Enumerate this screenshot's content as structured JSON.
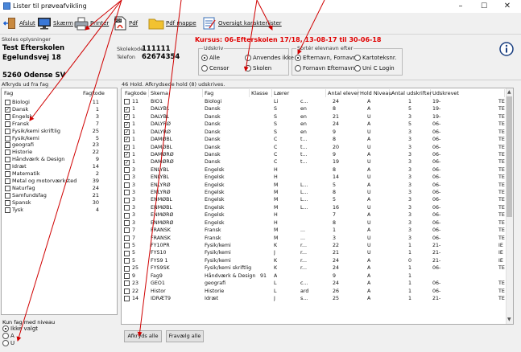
{
  "window": {
    "title": "Lister til prøveafvikling",
    "min": "–",
    "max": "☐",
    "close": "✕"
  },
  "toolbar": {
    "afslut": "Afslut",
    "skaerm": "Skærm",
    "printer": "Printer",
    "pdf": "Pdf",
    "pdf_mappe": "Pdf mappe",
    "oversigt": "Oversigt karakterlister"
  },
  "info": {
    "skoles_label": "Skoles oplysninger",
    "school_name": "Test Efterskolen",
    "street": "Egelundsvej 18",
    "postal": "5260 Odense SV",
    "skolekode_label": "Skolekode",
    "skolekode": "111111",
    "telefon_label": "Telefon",
    "telefon": "62674354",
    "kursus": "Kursus: 06-Efterskolen 17/18, 13-08-17 til 30-06-18",
    "udskriv_label": "Udskriv",
    "udskriv": [
      "Alle",
      "Anvendes ikke",
      "Censor",
      "Skolen"
    ],
    "sort_label": "Sortér elevnavn efter",
    "sort": [
      "Efternavn, Fornavn",
      "Kartoteksnr.",
      "Fornavn Efternavn",
      "Uni C Login"
    ]
  },
  "left": {
    "title": "Afkryds ud fra fag",
    "col_fag": "Fag",
    "col_fagkode": "Fagkode",
    "rows": [
      {
        "name": "Biologi",
        "num": "11",
        "checked": false
      },
      {
        "name": "Dansk",
        "num": "1",
        "checked": true
      },
      {
        "name": "Engelsk",
        "num": "3",
        "checked": false
      },
      {
        "name": "Fransk",
        "num": "7",
        "checked": false
      },
      {
        "name": "Fysik/kemi skriftlig",
        "num": "25",
        "checked": false
      },
      {
        "name": "Fysik/kemi",
        "num": "5",
        "checked": false
      },
      {
        "name": "geografi",
        "num": "23",
        "checked": false
      },
      {
        "name": "Historie",
        "num": "22",
        "checked": false
      },
      {
        "name": "Håndværk & Design",
        "num": "9",
        "checked": false
      },
      {
        "name": "Idræt",
        "num": "14",
        "checked": false
      },
      {
        "name": "Matematik",
        "num": "2",
        "checked": false
      },
      {
        "name": "Metal og motorværksted",
        "num": "39",
        "checked": false
      },
      {
        "name": "Naturfag",
        "num": "24",
        "checked": false
      },
      {
        "name": "Samfundsfag",
        "num": "21",
        "checked": false
      },
      {
        "name": "Spansk",
        "num": "30",
        "checked": false
      },
      {
        "name": "Tysk",
        "num": "4",
        "checked": false
      }
    ],
    "niveau_label": "Kun fag med niveau",
    "niveau": [
      "Ikke valgt",
      "A",
      "U"
    ]
  },
  "main": {
    "summary": "46 Hold. Afkrydsede hold (8) udskrives.",
    "headers": [
      "Fagkode",
      "Skema",
      "Fag",
      "Klasse",
      "Lærer",
      "Antal elever",
      "Hold Niveau",
      "Antal udskrifter",
      "Udskrevet"
    ],
    "rows": [
      {
        "c": false,
        "kode": "11",
        "skema": "BIO1",
        "fag": "Biologi",
        "klasse": "",
        "laerer": "Li",
        "l2": "c...",
        "antal": "24",
        "niv": "A",
        "udskr": "1",
        "udskrevet": "19-",
        "ex": "TE"
      },
      {
        "c": true,
        "kode": "1",
        "skema": "DALYBL",
        "fag": "Dansk",
        "klasse": "",
        "laerer": "S",
        "l2": "en",
        "antal": "8",
        "niv": "A",
        "udskr": "5",
        "udskrevet": "19-",
        "ex": "TE"
      },
      {
        "c": true,
        "kode": "1",
        "skema": "DALYBL",
        "fag": "Dansk",
        "klasse": "",
        "laerer": "S",
        "l2": "en",
        "antal": "21",
        "niv": "U",
        "udskr": "3",
        "udskrevet": "19-",
        "ex": "TE"
      },
      {
        "c": true,
        "kode": "1",
        "skema": "DALYRØ",
        "fag": "Dansk",
        "klasse": "",
        "laerer": "S",
        "l2": "en",
        "antal": "24",
        "niv": "A",
        "udskr": "5",
        "udskrevet": "06-",
        "ex": "TE"
      },
      {
        "c": true,
        "kode": "1",
        "skema": "DALYRØ",
        "fag": "Dansk",
        "klasse": "",
        "laerer": "S",
        "l2": "en",
        "antal": "9",
        "niv": "U",
        "udskr": "3",
        "udskrevet": "06-",
        "ex": "TE"
      },
      {
        "c": true,
        "kode": "1",
        "skema": "DAMØBL",
        "fag": "Dansk",
        "klasse": "",
        "laerer": "C",
        "l2": "t...",
        "antal": "8",
        "niv": "A",
        "udskr": "3",
        "udskrevet": "06-",
        "ex": "TE"
      },
      {
        "c": true,
        "kode": "1",
        "skema": "DAMØBL",
        "fag": "Dansk",
        "klasse": "",
        "laerer": "C",
        "l2": "t...",
        "antal": "20",
        "niv": "U",
        "udskr": "3",
        "udskrevet": "06-",
        "ex": "TE"
      },
      {
        "c": true,
        "kode": "1",
        "skema": "DAMØRØ",
        "fag": "Dansk",
        "klasse": "",
        "laerer": "C",
        "l2": "t...",
        "antal": "9",
        "niv": "A",
        "udskr": "3",
        "udskrevet": "06-",
        "ex": "TE"
      },
      {
        "c": true,
        "kode": "1",
        "skema": "DAMØRØ",
        "fag": "Dansk",
        "klasse": "",
        "laerer": "C",
        "l2": "t...",
        "antal": "19",
        "niv": "U",
        "udskr": "3",
        "udskrevet": "06-",
        "ex": "TE"
      },
      {
        "c": false,
        "kode": "3",
        "skema": "ENLYBL",
        "fag": "Engelsk",
        "klasse": "",
        "laerer": "H",
        "l2": "",
        "antal": "8",
        "niv": "A",
        "udskr": "3",
        "udskrevet": "06-",
        "ex": "TE"
      },
      {
        "c": false,
        "kode": "3",
        "skema": "ENLYBL",
        "fag": "Engelsk",
        "klasse": "",
        "laerer": "H",
        "l2": "",
        "antal": "14",
        "niv": "U",
        "udskr": "3",
        "udskrevet": "06-",
        "ex": "TE"
      },
      {
        "c": false,
        "kode": "3",
        "skema": "ENLYRØ",
        "fag": "Engelsk",
        "klasse": "",
        "laerer": "M",
        "l2": "L...",
        "antal": "5",
        "niv": "A",
        "udskr": "3",
        "udskrevet": "06-",
        "ex": "TE"
      },
      {
        "c": false,
        "kode": "3",
        "skema": "ENLYRØ",
        "fag": "Engelsk",
        "klasse": "",
        "laerer": "M",
        "l2": "L...",
        "antal": "8",
        "niv": "U",
        "udskr": "3",
        "udskrevet": "06-",
        "ex": "TE"
      },
      {
        "c": false,
        "kode": "3",
        "skema": "ENMØBL",
        "fag": "Engelsk",
        "klasse": "",
        "laerer": "M",
        "l2": "L...",
        "antal": "5",
        "niv": "A",
        "udskr": "3",
        "udskrevet": "06-",
        "ex": "TE"
      },
      {
        "c": false,
        "kode": "3",
        "skema": "ENMØBL",
        "fag": "Engelsk",
        "klasse": "",
        "laerer": "M",
        "l2": "L...",
        "antal": "16",
        "niv": "U",
        "udskr": "3",
        "udskrevet": "06-",
        "ex": "TE"
      },
      {
        "c": false,
        "kode": "3",
        "skema": "ENMØRØ",
        "fag": "Engelsk",
        "klasse": "",
        "laerer": "H",
        "l2": "",
        "antal": "7",
        "niv": "A",
        "udskr": "3",
        "udskrevet": "06-",
        "ex": "TE"
      },
      {
        "c": false,
        "kode": "3",
        "skema": "ENMØRØ",
        "fag": "Engelsk",
        "klasse": "",
        "laerer": "H",
        "l2": "",
        "antal": "8",
        "niv": "U",
        "udskr": "3",
        "udskrevet": "06-",
        "ex": "TE"
      },
      {
        "c": false,
        "kode": "7",
        "skema": "FRANSK",
        "fag": "Fransk",
        "klasse": "",
        "laerer": "M",
        "l2": "...",
        "antal": "1",
        "niv": "A",
        "udskr": "3",
        "udskrevet": "06-",
        "ex": "TE"
      },
      {
        "c": false,
        "kode": "7",
        "skema": "FRANSK",
        "fag": "Fransk",
        "klasse": "",
        "laerer": "M",
        "l2": "...",
        "antal": "3",
        "niv": "U",
        "udskr": "3",
        "udskrevet": "06-",
        "ex": "TE"
      },
      {
        "c": false,
        "kode": "5",
        "skema": "FY10PR",
        "fag": "Fysik/kemi",
        "klasse": "",
        "laerer": "K",
        "l2": "r...",
        "antal": "22",
        "niv": "U",
        "udskr": "1",
        "udskrevet": "21-",
        "ex": "IE"
      },
      {
        "c": false,
        "kode": "5",
        "skema": "FYS10",
        "fag": "Fysik/kemi",
        "klasse": "",
        "laerer": "J",
        "l2": "r...",
        "antal": "21",
        "niv": "U",
        "udskr": "1",
        "udskrevet": "21-",
        "ex": "IE"
      },
      {
        "c": false,
        "kode": "5",
        "skema": "FYS9 1",
        "fag": "Fysik/kemi",
        "klasse": "",
        "laerer": "K",
        "l2": "r...",
        "antal": "24",
        "niv": "A",
        "udskr": "0",
        "udskrevet": "21-",
        "ex": "IE"
      },
      {
        "c": false,
        "kode": "25",
        "skema": "FYS9SK",
        "fag": "Fysik/kemi skriftlig",
        "klasse": "",
        "laerer": "K",
        "l2": "r...",
        "antal": "24",
        "niv": "A",
        "udskr": "1",
        "udskrevet": "06-",
        "ex": "TE"
      },
      {
        "c": false,
        "kode": "9",
        "skema": "Fag9",
        "fag": "Håndværk & Design",
        "klasse": "91",
        "laerer": "A",
        "l2": "",
        "antal": "9",
        "niv": "A",
        "udskr": "1",
        "udskrevet": "",
        "ex": ""
      },
      {
        "c": false,
        "kode": "23",
        "skema": "GEO1",
        "fag": "geografi",
        "klasse": "",
        "laerer": "L",
        "l2": "c...",
        "antal": "24",
        "niv": "A",
        "udskr": "1",
        "udskrevet": "06-",
        "ex": "TE"
      },
      {
        "c": false,
        "kode": "22",
        "skema": "Histor",
        "fag": "Historie",
        "klasse": "",
        "laerer": "L",
        "l2": "ard",
        "antal": "26",
        "niv": "A",
        "udskr": "1",
        "udskrevet": "06-",
        "ex": "TE"
      },
      {
        "c": false,
        "kode": "14",
        "skema": "IDRÆT9",
        "fag": "Idræt",
        "klasse": "",
        "laerer": "J",
        "l2": "s...",
        "antal": "25",
        "niv": "A",
        "udskr": "1",
        "udskrevet": "21-",
        "ex": "TE"
      }
    ]
  },
  "buttons": {
    "afkryds_alle": "Afkryds alle",
    "fravaelg_alle": "Fravælg alle"
  },
  "colors": {
    "accent_red": "#e00000",
    "arrow": "#d00000"
  }
}
